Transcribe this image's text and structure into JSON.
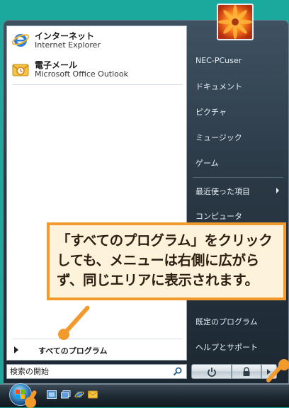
{
  "pinned": [
    {
      "title": "インターネット",
      "subtitle": "Internet Explorer",
      "icon": "internet-explorer-icon"
    },
    {
      "title": "電子メール",
      "subtitle": "Microsoft Office Outlook",
      "icon": "outlook-icon"
    }
  ],
  "all_programs_label": "すべてのプログラム",
  "search": {
    "placeholder": "検索の開始"
  },
  "right_menu": {
    "user": "NEC-PCuser",
    "documents": "ドキュメント",
    "pictures": "ピクチャ",
    "music": "ミュージック",
    "games": "ゲーム",
    "recent_items": "最近使った項目",
    "computer": "コンピュータ",
    "default_programs": "既定のプログラム",
    "help": "ヘルプとサポート"
  },
  "callout": {
    "line1": "「すべてのプログラム」をクリック",
    "line2": "しても、メニューは右側に広がら",
    "line3": "ず、同じエリアに表示されます。"
  },
  "colors": {
    "accent": "#f39a2c",
    "background": "#1ba99e",
    "callout_bg": "#fdf3da"
  }
}
